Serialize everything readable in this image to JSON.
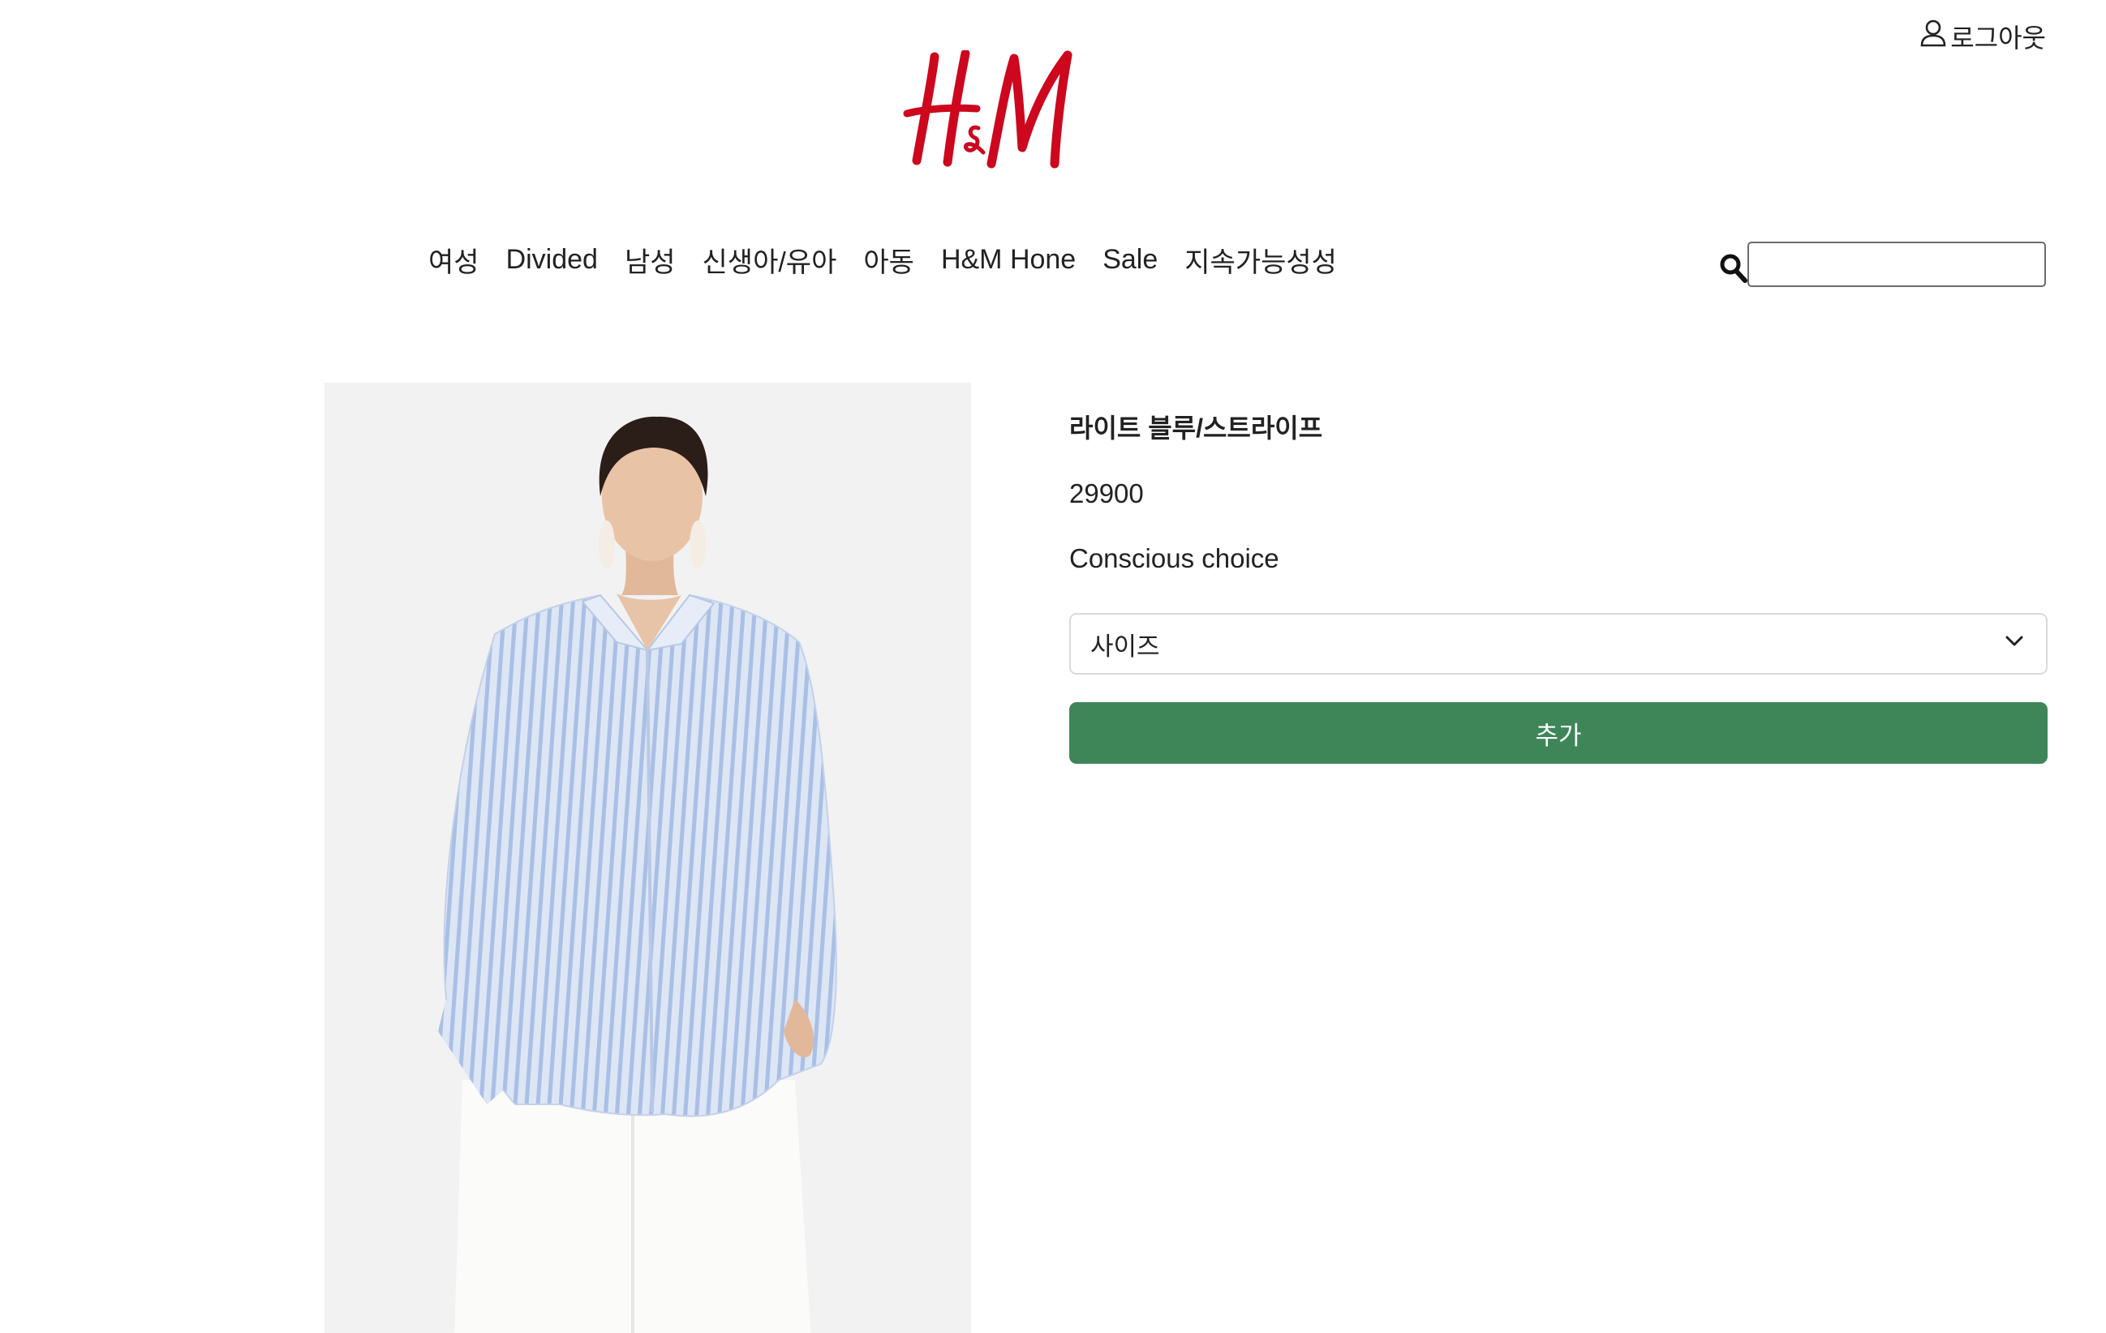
{
  "header": {
    "account_label": "로그아웃",
    "logo_alt": "H&M"
  },
  "nav": {
    "items": [
      {
        "label": "여성"
      },
      {
        "label": "Divided"
      },
      {
        "label": "남성"
      },
      {
        "label": "신생아/유아"
      },
      {
        "label": "아동"
      },
      {
        "label": "H&M Hone"
      },
      {
        "label": "Sale"
      },
      {
        "label": "지속가능성성"
      }
    ]
  },
  "search": {
    "value": "",
    "placeholder": ""
  },
  "product": {
    "name": "라이트 블루/스트라이프",
    "price": "29900",
    "tag": "Conscious choice",
    "size_select_label": "사이즈",
    "add_button_label": "추가"
  },
  "colors": {
    "brand_red": "#cc071e",
    "add_button": "#3e8658",
    "image_bg": "#f2f2f2"
  },
  "icons": {
    "account": "user-icon",
    "search": "search-icon",
    "select_chevron": "chevron-down-icon"
  }
}
